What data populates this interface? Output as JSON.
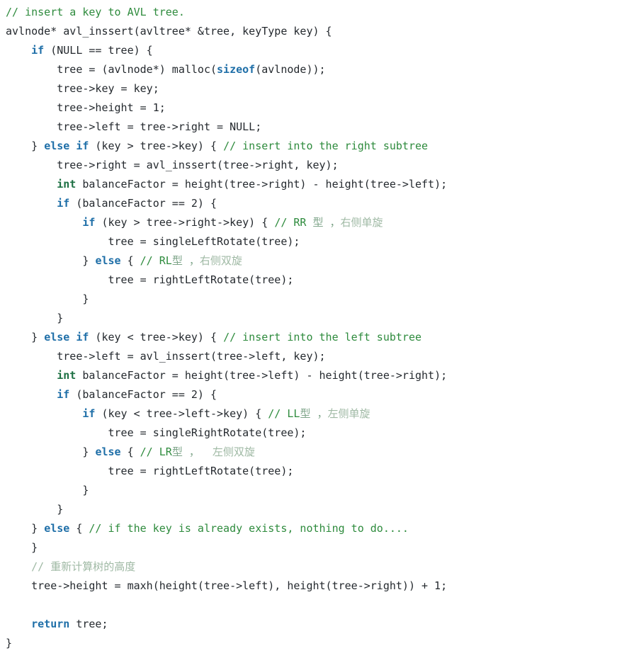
{
  "document": {
    "kind": "source-code-listing",
    "language": "C++",
    "function_name": "avl_inssert",
    "background_color": "#ffffff",
    "colors": {
      "plain_text": "#24292e",
      "keyword": "#1f6fa8",
      "type_keyword": "#1d7043",
      "comment": "#2e8b3d",
      "comment_chinese": "#9fb9a4",
      "comment_mid": "#7fa58a"
    }
  },
  "code": {
    "lines": [
      {
        "indent": 0,
        "tokens": [
          {
            "c": "cmt",
            "t": "// insert a key to AVL tree."
          }
        ]
      },
      {
        "indent": 0,
        "tokens": [
          {
            "c": "plain",
            "t": "avlnode* avl_inssert(avltree* &tree, keyType key) {"
          }
        ]
      },
      {
        "indent": 0,
        "tokens": [
          {
            "c": "plain",
            "t": "    "
          },
          {
            "c": "kw",
            "t": "if"
          },
          {
            "c": "plain",
            "t": " (NULL == tree) {"
          }
        ]
      },
      {
        "indent": 0,
        "tokens": [
          {
            "c": "plain",
            "t": "        tree = (avlnode*) malloc("
          },
          {
            "c": "kw",
            "t": "sizeof"
          },
          {
            "c": "plain",
            "t": "(avlnode));"
          }
        ]
      },
      {
        "indent": 0,
        "tokens": [
          {
            "c": "plain",
            "t": "        tree->key = key;"
          }
        ]
      },
      {
        "indent": 0,
        "tokens": [
          {
            "c": "plain",
            "t": "        tree->height = 1;"
          }
        ]
      },
      {
        "indent": 0,
        "tokens": [
          {
            "c": "plain",
            "t": "        tree->left = tree->right = NULL;"
          }
        ]
      },
      {
        "indent": 0,
        "tokens": [
          {
            "c": "plain",
            "t": "    } "
          },
          {
            "c": "kw",
            "t": "else if"
          },
          {
            "c": "plain",
            "t": " (key > tree->key) { "
          },
          {
            "c": "cmt",
            "t": "// insert into the right subtree"
          }
        ]
      },
      {
        "indent": 0,
        "tokens": [
          {
            "c": "plain",
            "t": "        tree->right = avl_inssert(tree->right, key);"
          }
        ]
      },
      {
        "indent": 0,
        "tokens": [
          {
            "c": "plain",
            "t": "        "
          },
          {
            "c": "type",
            "t": "int"
          },
          {
            "c": "plain",
            "t": " balanceFactor = height(tree->right) - height(tree->left);"
          }
        ]
      },
      {
        "indent": 0,
        "tokens": [
          {
            "c": "plain",
            "t": "        "
          },
          {
            "c": "kw",
            "t": "if"
          },
          {
            "c": "plain",
            "t": " (balanceFactor == 2) {"
          }
        ]
      },
      {
        "indent": 0,
        "tokens": [
          {
            "c": "plain",
            "t": "            "
          },
          {
            "c": "kw",
            "t": "if"
          },
          {
            "c": "plain",
            "t": " (key > tree->right->key) { "
          },
          {
            "c": "cmt",
            "t": "// RR "
          },
          {
            "c": "cmt-mid",
            "t": "型 ，"
          },
          {
            "c": "cmt-cn",
            "t": "右侧单旋"
          }
        ]
      },
      {
        "indent": 0,
        "tokens": [
          {
            "c": "plain",
            "t": "                tree = singleLeftRotate(tree);"
          }
        ]
      },
      {
        "indent": 0,
        "tokens": [
          {
            "c": "plain",
            "t": "            } "
          },
          {
            "c": "kw",
            "t": "else"
          },
          {
            "c": "plain",
            "t": " { "
          },
          {
            "c": "cmt",
            "t": "// RL"
          },
          {
            "c": "cmt-mid",
            "t": "型 ，"
          },
          {
            "c": "cmt-cn",
            "t": "右侧双旋"
          }
        ]
      },
      {
        "indent": 0,
        "tokens": [
          {
            "c": "plain",
            "t": "                tree = rightLeftRotate(tree);"
          }
        ]
      },
      {
        "indent": 0,
        "tokens": [
          {
            "c": "plain",
            "t": "            }"
          }
        ]
      },
      {
        "indent": 0,
        "tokens": [
          {
            "c": "plain",
            "t": "        }"
          }
        ]
      },
      {
        "indent": 0,
        "tokens": [
          {
            "c": "plain",
            "t": "    } "
          },
          {
            "c": "kw",
            "t": "else if"
          },
          {
            "c": "plain",
            "t": " (key < tree->key) { "
          },
          {
            "c": "cmt",
            "t": "// insert into the left subtree"
          }
        ]
      },
      {
        "indent": 0,
        "tokens": [
          {
            "c": "plain",
            "t": "        tree->left = avl_inssert(tree->left, key);"
          }
        ]
      },
      {
        "indent": 0,
        "tokens": [
          {
            "c": "plain",
            "t": "        "
          },
          {
            "c": "type",
            "t": "int"
          },
          {
            "c": "plain",
            "t": " balanceFactor = height(tree->left) - height(tree->right);"
          }
        ]
      },
      {
        "indent": 0,
        "tokens": [
          {
            "c": "plain",
            "t": "        "
          },
          {
            "c": "kw",
            "t": "if"
          },
          {
            "c": "plain",
            "t": " (balanceFactor == 2) {"
          }
        ]
      },
      {
        "indent": 0,
        "tokens": [
          {
            "c": "plain",
            "t": "            "
          },
          {
            "c": "kw",
            "t": "if"
          },
          {
            "c": "plain",
            "t": " (key < tree->left->key) { "
          },
          {
            "c": "cmt",
            "t": "// LL"
          },
          {
            "c": "cmt-mid",
            "t": "型 ，"
          },
          {
            "c": "cmt-cn",
            "t": "左侧单旋"
          }
        ]
      },
      {
        "indent": 0,
        "tokens": [
          {
            "c": "plain",
            "t": "                tree = singleRightRotate(tree);"
          }
        ]
      },
      {
        "indent": 0,
        "tokens": [
          {
            "c": "plain",
            "t": "            } "
          },
          {
            "c": "kw",
            "t": "else"
          },
          {
            "c": "plain",
            "t": " { "
          },
          {
            "c": "cmt",
            "t": "// LR"
          },
          {
            "c": "cmt-mid",
            "t": "型 ，  "
          },
          {
            "c": "cmt-cn",
            "t": "左侧双旋"
          }
        ]
      },
      {
        "indent": 0,
        "tokens": [
          {
            "c": "plain",
            "t": "                tree = rightLeftRotate(tree);"
          }
        ]
      },
      {
        "indent": 0,
        "tokens": [
          {
            "c": "plain",
            "t": "            }"
          }
        ]
      },
      {
        "indent": 0,
        "tokens": [
          {
            "c": "plain",
            "t": "        }"
          }
        ]
      },
      {
        "indent": 0,
        "tokens": [
          {
            "c": "plain",
            "t": "    } "
          },
          {
            "c": "kw",
            "t": "else"
          },
          {
            "c": "plain",
            "t": " { "
          },
          {
            "c": "cmt",
            "t": "// if the key is already exists, nothing to do...."
          }
        ]
      },
      {
        "indent": 0,
        "tokens": [
          {
            "c": "plain",
            "t": "    }"
          }
        ]
      },
      {
        "indent": 0,
        "tokens": [
          {
            "c": "plain",
            "t": "    "
          },
          {
            "c": "cmt-cn",
            "t": "// 重新计算树的高度"
          }
        ]
      },
      {
        "indent": 0,
        "tokens": [
          {
            "c": "plain",
            "t": "    tree->height = maxh(height(tree->left), height(tree->right)) + 1;"
          }
        ]
      },
      {
        "indent": 0,
        "tokens": [
          {
            "c": "plain",
            "t": ""
          }
        ]
      },
      {
        "indent": 0,
        "tokens": [
          {
            "c": "plain",
            "t": "    "
          },
          {
            "c": "kw",
            "t": "return"
          },
          {
            "c": "plain",
            "t": " tree;"
          }
        ]
      },
      {
        "indent": 0,
        "tokens": [
          {
            "c": "plain",
            "t": "}"
          }
        ]
      }
    ]
  }
}
